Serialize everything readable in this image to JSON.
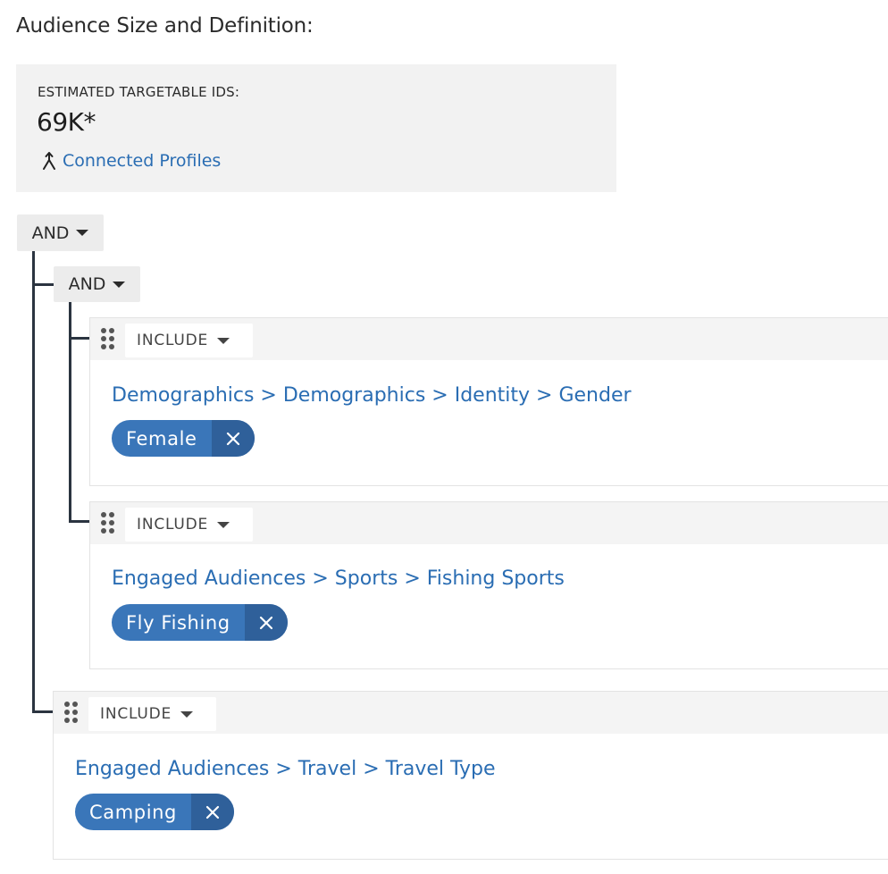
{
  "header": {
    "title": "Audience Size and Definition:"
  },
  "summary": {
    "label": "ESTIMATED TARGETABLE IDS:",
    "value": "69K*",
    "link": "Connected Profiles",
    "link_icon": "merge-icon"
  },
  "root_group": {
    "operator": "AND"
  },
  "nested_group": {
    "operator": "AND"
  },
  "criteria": [
    {
      "mode": "INCLUDE",
      "path": "Demographics > Demographics > Identity > Gender",
      "value": "Female"
    },
    {
      "mode": "INCLUDE",
      "path": "Engaged Audiences > Sports > Fishing Sports",
      "value": "Fly Fishing"
    },
    {
      "mode": "INCLUDE",
      "path": "Engaged Audiences > Travel > Travel Type",
      "value": "Camping"
    }
  ],
  "colors": {
    "link": "#2a6db3",
    "chip": "#3a76b9",
    "chip_close": "#2f609a",
    "tree_line": "#2b3440",
    "panel": "#f2f2f2"
  }
}
